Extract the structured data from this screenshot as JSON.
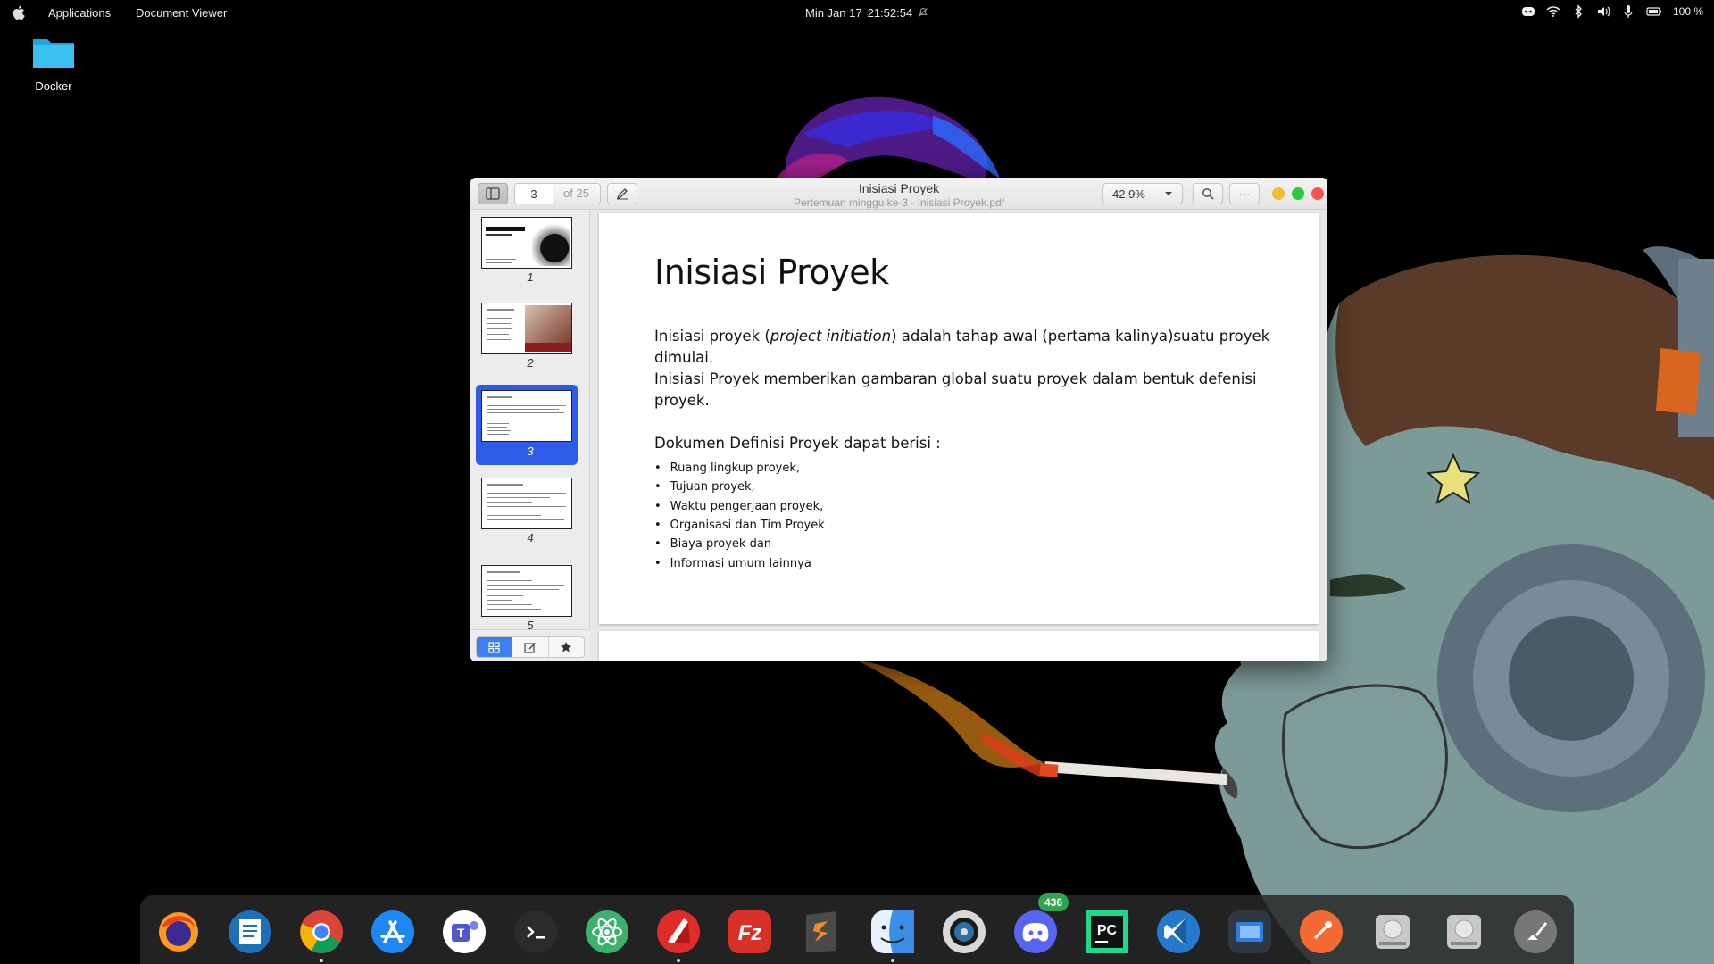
{
  "topbar": {
    "apps_menu": "Applications",
    "active_app": "Document Viewer",
    "date": "Min Jan 17",
    "time": "21:52:54",
    "battery": "100 %"
  },
  "desktop": {
    "icons": [
      {
        "label": "Docker",
        "icon": "folder-icon"
      }
    ]
  },
  "viewer": {
    "page_current": "3",
    "page_total": "of 25",
    "title": "Inisiasi Proyek",
    "subtitle": "Pertemuan minggu ke-3 - Inisiasi Proyek.pdf",
    "zoom": "42,9%",
    "more": "···",
    "thumbnails": [
      {
        "num": "1",
        "selected": false
      },
      {
        "num": "2",
        "selected": false
      },
      {
        "num": "3",
        "selected": true
      },
      {
        "num": "4",
        "selected": false
      },
      {
        "num": "5",
        "selected": false
      }
    ],
    "slide": {
      "heading": "Inisiasi Proyek",
      "p1_before": "Inisiasi proyek (",
      "p1_italic": "project initiation",
      "p1_after": ") adalah tahap awal (pertama kalinya)suatu proyek dimulai.",
      "p2": "Inisiasi Proyek memberikan gambaran global suatu proyek dalam bentuk defenisi proyek.",
      "sub": "Dokumen Definisi Proyek dapat berisi :",
      "bullets": [
        "Ruang lingkup proyek,",
        "Tujuan proyek,",
        "Waktu pengerjaan proyek,",
        "Organisasi dan Tim Proyek",
        "Biaya proyek dan",
        "Informasi umum lainnya"
      ]
    }
  },
  "dock": {
    "items": [
      {
        "name": "firefox-icon",
        "color": "#e8631a"
      },
      {
        "name": "libreoffice-writer-icon",
        "color": "#1d6fb8"
      },
      {
        "name": "chrome-icon",
        "color": "#ffffff"
      },
      {
        "name": "app-store-icon",
        "color": "#1e88f0"
      },
      {
        "name": "teams-icon",
        "color": "#ffffff"
      },
      {
        "name": "terminal-icon",
        "color": "#2b2b2b"
      },
      {
        "name": "atom-icon",
        "color": "#3bb26b"
      },
      {
        "name": "document-viewer-icon",
        "color": "#e02b2b"
      },
      {
        "name": "filezilla-icon",
        "color": "#d83228"
      },
      {
        "name": "sublime-text-icon",
        "color": "#4a4a4a"
      },
      {
        "name": "finder-icon",
        "color": "#3a8ee6"
      },
      {
        "name": "disk-utility-icon",
        "color": "#d8d8d8"
      },
      {
        "name": "discord-icon",
        "color": "#5865f2"
      },
      {
        "name": "pycharm-icon",
        "color": "#111111"
      },
      {
        "name": "vscode-icon",
        "color": "#2479cc"
      },
      {
        "name": "screenshot-icon",
        "color": "#2f3742"
      },
      {
        "name": "postman-icon",
        "color": "#f36b32"
      },
      {
        "name": "drive-icon",
        "color": "#b8b8b8"
      },
      {
        "name": "drive-2-icon",
        "color": "#b8b8b8"
      },
      {
        "name": "launchpad-icon",
        "color": "#777777"
      }
    ],
    "discord_badge": "436"
  }
}
